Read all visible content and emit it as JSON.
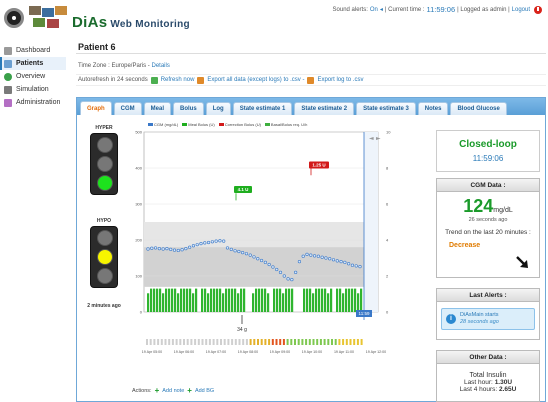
{
  "app": {
    "title_main": "DiAs",
    "title_sub": "Web Monitoring"
  },
  "top_status": {
    "sound_label": "Sound alerts:",
    "sound_value": "On",
    "current_time_label": "| Current time :",
    "current_time": "11:59:06",
    "logged_as": "| Logged as admin |",
    "logout": "Logout"
  },
  "sidebar": {
    "items": [
      {
        "label": "Dashboard",
        "icon": "home-icon"
      },
      {
        "label": "Patients",
        "icon": "patients-icon"
      },
      {
        "label": "Overview",
        "icon": "overview-icon"
      },
      {
        "label": "Simulation",
        "icon": "simulation-icon"
      },
      {
        "label": "Administration",
        "icon": "admin-icon"
      }
    ]
  },
  "patient": {
    "title": "Patient 6",
    "timezone_label": "Time Zone : Europe/Paris -",
    "details_link": "Details"
  },
  "autorefresh": {
    "text": "Autorefresh in 24 seconds",
    "refresh_now": "Refresh now",
    "export_all": "Export all data (except logs) to .csv -",
    "export_log": "Export log to .csv"
  },
  "tabs": [
    "Graph",
    "CGM",
    "Meal",
    "Bolus",
    "Log",
    "State estimate 1",
    "State estimate 2",
    "State estimate 3",
    "Notes",
    "Blood Glucose"
  ],
  "lights": {
    "hyper_label": "HYPER",
    "hypo_label": "HYPO",
    "hyper_ago": "",
    "hypo_ago": "2 minutes ago"
  },
  "chart_data": {
    "type": "line",
    "legend": [
      "CGM (mg/dL)",
      "Meal Bolus (U)",
      "Correction Bolus (U)",
      "Basal/Bolus req. U/h"
    ],
    "y_left_ticks": [
      "500",
      "400",
      "300",
      "200",
      "100",
      "0"
    ],
    "y_right_ticks": [
      "10",
      "8",
      "6",
      "4",
      "2",
      "0"
    ],
    "x_ticks": [
      "19 Apr 05:00",
      "19 Apr 06:00",
      "19 Apr 07:00",
      "19 Apr 08:00",
      "19 Apr 09:00",
      "19 Apr 10:00",
      "19 Apr 11:00",
      "19 Apr 12:00"
    ],
    "annotations": [
      {
        "text": "4.1 U",
        "color": "#1fae1f"
      },
      {
        "text": "1.25 U",
        "color": "#d21a1a"
      },
      {
        "text": "34 g",
        "color": "#333333"
      }
    ],
    "current_time_label": "11:59",
    "nav_arrows": [
      "◄",
      "►"
    ],
    "cgm_values": [
      175,
      177,
      178,
      176,
      175,
      176,
      174,
      172,
      171,
      173,
      176,
      180,
      184,
      187,
      190,
      192,
      193,
      195,
      197,
      198,
      197,
      178,
      174,
      170,
      168,
      165,
      162,
      158,
      153,
      148,
      143,
      138,
      132,
      125,
      118,
      110,
      100,
      92,
      90,
      110,
      140,
      155,
      160,
      158,
      156,
      155,
      152,
      150,
      148,
      145,
      142,
      140,
      138,
      134,
      130,
      128,
      126
    ],
    "ylim": [
      0,
      500
    ]
  },
  "panels": {
    "loop_mode": "Closed-loop",
    "loop_time": "11:59:06",
    "cgm_head": "CGM Data :",
    "cgm_value": "124",
    "cgm_unit": "mg/dL",
    "cgm_ago": "26 seconds ago",
    "trend_label": "Trend on the last 20 minutes :",
    "trend_value": "Decrease",
    "alerts_head": "Last Alerts :",
    "alert_title": "DiAsMain starts",
    "alert_ago": "28 seconds ago",
    "other_head": "Other Data :",
    "total_insulin": "Total Insulin",
    "last_hour_label": "Last hour:",
    "last_hour_value": "1.30U",
    "last4_label": "Last 4 hours:",
    "last4_value": "2.65U"
  },
  "actions": {
    "label": "Actions:",
    "add_note": "Add note",
    "add_bg": "Add BG"
  },
  "colors": {
    "accent_blue": "#2a7ab8",
    "green": "#1a9a2a",
    "red": "#d21a1a",
    "orange": "#e07b00"
  }
}
